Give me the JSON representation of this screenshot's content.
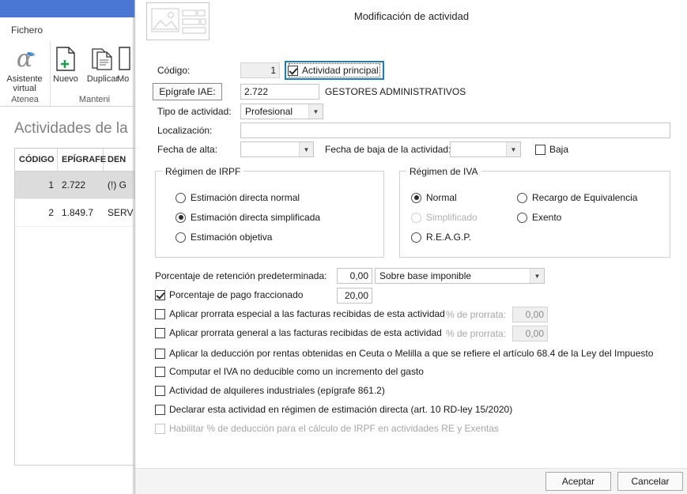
{
  "window": {
    "title": "Actividades de la empresa",
    "close_icon": "close-icon"
  },
  "ribbon": {
    "tab_fichero": "Fichero",
    "groups": [
      {
        "caption": "Atenea",
        "items": [
          {
            "label_line1": "Asistente",
            "label_line2": "virtual",
            "icon": "alpha-assistant-icon"
          }
        ]
      },
      {
        "caption": "Manteni",
        "items": [
          {
            "label_line1": "Nuevo",
            "label_line2": "",
            "icon": "new-document-icon"
          },
          {
            "label_line1": "Duplicar",
            "label_line2": "",
            "icon": "duplicate-document-icon"
          },
          {
            "label_line1": "Mo",
            "label_line2": "",
            "icon": "modify-document-icon"
          }
        ]
      }
    ]
  },
  "page": {
    "title": "Actividades de la",
    "grid": {
      "headers": [
        "CÓDIGO",
        "EPÍGRAFE",
        "DEN"
      ],
      "rows": [
        {
          "codigo": "1",
          "epigrafe": "2.722",
          "denominacion": "(!) G",
          "selected": true
        },
        {
          "codigo": "2",
          "epigrafe": "1.849.7",
          "denominacion": "SERV",
          "selected": false
        }
      ]
    },
    "splitter_arrow": "❯"
  },
  "dialog": {
    "icon_name": "form-preview-icon",
    "header_title": "Modificación de actividad",
    "codigo": {
      "label": "Código:",
      "value": "1"
    },
    "actividad_principal": {
      "label": "Actividad principal",
      "checked": true,
      "focused": true
    },
    "epigrafe_iae": {
      "button_label": "Epígrafe IAE:",
      "value": "2.722",
      "description": "GESTORES ADMINISTRATIVOS"
    },
    "tipo_actividad": {
      "label": "Tipo de actividad:",
      "value": "Profesional"
    },
    "localizacion": {
      "label": "Localización:",
      "value": ""
    },
    "fecha_alta": {
      "label": "Fecha de alta:",
      "value": ""
    },
    "fecha_baja": {
      "label": "Fecha de baja de la actividad:",
      "value": ""
    },
    "baja": {
      "label": "Baja",
      "checked": false
    },
    "regimen_irpf": {
      "legend": "Régimen de IRPF",
      "options": [
        {
          "label": "Estimación directa normal",
          "selected": false,
          "disabled": false
        },
        {
          "label": "Estimación directa simplificada",
          "selected": true,
          "disabled": false
        },
        {
          "label": "Estimación objetiva",
          "selected": false,
          "disabled": false
        }
      ]
    },
    "regimen_iva": {
      "legend": "Régimen de IVA",
      "col1": [
        {
          "label": "Normal",
          "selected": true,
          "disabled": false
        },
        {
          "label": "Simplificado",
          "selected": false,
          "disabled": true
        },
        {
          "label": "R.E.A.G.P.",
          "selected": false,
          "disabled": false
        }
      ],
      "col2": [
        {
          "label": "Recargo de Equivalencia",
          "selected": false,
          "disabled": false
        },
        {
          "label": "Exento",
          "selected": false,
          "disabled": false
        }
      ]
    },
    "retencion": {
      "label": "Porcentaje de retención predeterminada:",
      "value": "0,00",
      "base_value": "Sobre base imponible"
    },
    "pago_fraccionado": {
      "label": "Porcentaje de pago fraccionado",
      "checked": true,
      "value": "20,00"
    },
    "prorrata_especial": {
      "label": "Aplicar prorrata especial a las facturas recibidas de esta actividad",
      "checked": false,
      "pct_label": "% de prorrata:",
      "pct_value": "0,00"
    },
    "prorrata_general": {
      "label": "Aplicar prorrata general a las facturas recibidas de esta actividad",
      "checked": false,
      "pct_label": "% de prorrata:",
      "pct_value": "0,00"
    },
    "checkboxes": [
      {
        "label": "Aplicar la deducción por rentas obtenidas en Ceuta o Melilla a que se refiere el artículo 68.4 de la Ley del Impuesto",
        "checked": false,
        "disabled": false
      },
      {
        "label": "Computar el IVA no deducible como un incremento del gasto",
        "checked": false,
        "disabled": false
      },
      {
        "label": "Actividad de alquileres industriales (epígrafe 861.2)",
        "checked": false,
        "disabled": false
      },
      {
        "label": "Declarar esta actividad en régimen de estimación directa (art. 10 RD-ley 15/2020)",
        "checked": false,
        "disabled": false
      },
      {
        "label": "Habilitar % de deducción para el cálculo de IRPF en actividades RE y Exentas",
        "checked": false,
        "disabled": true
      }
    ],
    "buttons": {
      "accept": "Aceptar",
      "cancel": "Cancelar"
    }
  },
  "colors": {
    "titlebar": "#4a77d4",
    "focus_ring": "#1a7fc1",
    "selection_row": "#dcdcdc"
  }
}
